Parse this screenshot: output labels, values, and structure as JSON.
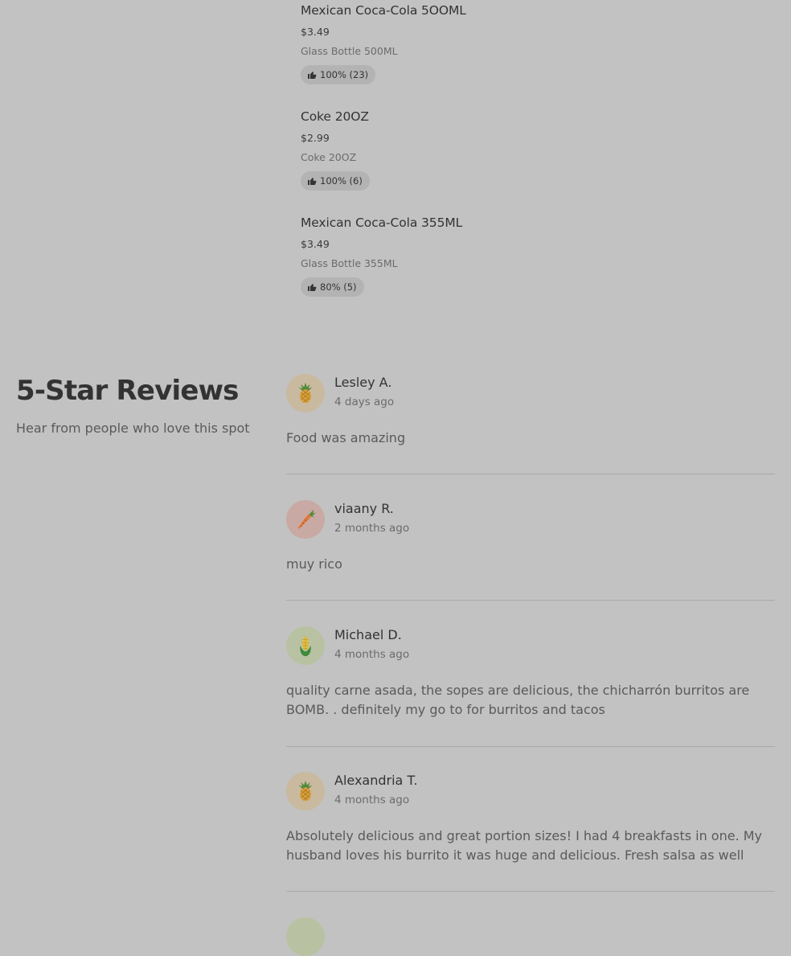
{
  "menu_items": [
    {
      "name": "Mexican Coca-Cola 5OOML",
      "price": "$3.49",
      "description": "Glass Bottle 500ML",
      "rating": "100% (23)"
    },
    {
      "name": "Coke 20OZ",
      "price": "$2.99",
      "description": "Coke 20OZ",
      "rating": "100% (6)"
    },
    {
      "name": "Mexican Coca-Cola 355ML",
      "price": "$3.49",
      "description": "Glass Bottle 355ML",
      "rating": "80% (5)"
    }
  ],
  "reviews_section": {
    "title": "5-Star Reviews",
    "subtitle": "Hear from people who love this spot",
    "reviews": [
      {
        "name": "Lesley A.",
        "date": "4 days ago",
        "text": "Food was amazing",
        "avatar_icon": "pineapple-icon",
        "avatar_color": "#c9b99f"
      },
      {
        "name": "viaany R.",
        "date": "2 months ago",
        "text": "muy rico",
        "avatar_icon": "carrot-icon",
        "avatar_color": "#c9a9a3"
      },
      {
        "name": "Michael D.",
        "date": "4 months ago",
        "text": "quality carne asada, the sopes are delicious, the chicharrón burritos are BOMB. . definitely my go to for burritos and tacos",
        "avatar_icon": "corn-icon",
        "avatar_color": "#b8c2a3"
      },
      {
        "name": "Alexandria T.",
        "date": "4 months ago",
        "text": "Absolutely delicious and great portion sizes! I had 4 breakfasts in one. My husband loves his burrito it was huge and delicious. Fresh salsa as well",
        "avatar_icon": "pineapple-icon",
        "avatar_color": "#c9b99f"
      }
    ]
  },
  "colors": {
    "page_background": "#c2c2c2",
    "rating_pill_background": "#b3b3b3",
    "text_primary": "#333333",
    "text_secondary": "#6b6b6b"
  }
}
